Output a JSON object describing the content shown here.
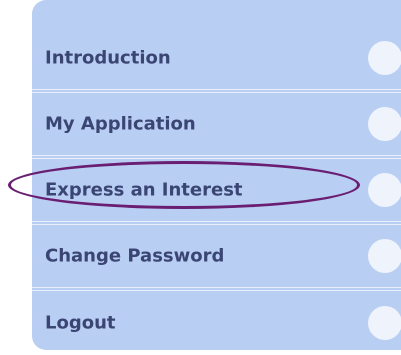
{
  "nav": {
    "items": [
      {
        "label": "Introduction",
        "icon": "circle-bullet-icon"
      },
      {
        "label": "My Application",
        "icon": "circle-bullet-icon"
      },
      {
        "label": "Express an Interest",
        "icon": "circle-bullet-icon"
      },
      {
        "label": "Change Password",
        "icon": "circle-bullet-icon"
      },
      {
        "label": "Logout",
        "icon": "circle-bullet-icon"
      }
    ]
  },
  "colors": {
    "panel_background": "#b9cef3",
    "label_text": "#3a4573",
    "divider": "#e8effb",
    "highlight_ellipse": "#6a1e72"
  }
}
